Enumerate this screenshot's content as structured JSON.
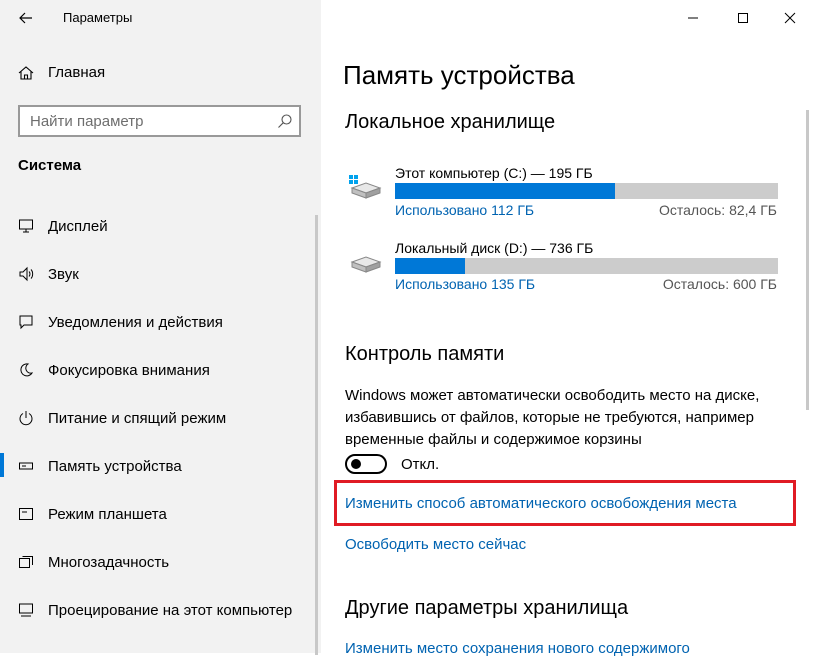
{
  "app_title": "Параметры",
  "sidebar": {
    "home_label": "Главная",
    "search_placeholder": "Найти параметр",
    "section_title": "Система",
    "items": [
      {
        "label": "Дисплей",
        "icon": "display-icon"
      },
      {
        "label": "Звук",
        "icon": "sound-icon"
      },
      {
        "label": "Уведомления и действия",
        "icon": "notifications-icon"
      },
      {
        "label": "Фокусировка внимания",
        "icon": "focus-assist-icon"
      },
      {
        "label": "Питание и спящий режим",
        "icon": "power-icon"
      },
      {
        "label": "Память устройства",
        "icon": "storage-icon",
        "active": true
      },
      {
        "label": "Режим планшета",
        "icon": "tablet-mode-icon"
      },
      {
        "label": "Многозадачность",
        "icon": "multitasking-icon"
      },
      {
        "label": "Проецирование на этот компьютер",
        "icon": "projecting-icon"
      }
    ]
  },
  "main": {
    "title": "Память устройства",
    "local_storage_title": "Локальное хранилище",
    "drives": [
      {
        "name": "Этот компьютер (C:) — 195 ГБ",
        "used": "Использовано 112 ГБ",
        "free": "Осталось: 82,4 ГБ",
        "used_fraction": 0.574,
        "icon": "windows-drive-icon"
      },
      {
        "name": "Локальный диск (D:) — 736 ГБ",
        "used": "Использовано 135 ГБ",
        "free": "Осталось: 600 ГБ",
        "used_fraction": 0.183,
        "icon": "drive-icon"
      }
    ],
    "storage_sense_title": "Контроль памяти",
    "storage_sense_desc": "Windows может автоматически освободить место на диске, избавившись от файлов, которые не требуются, например временные файлы и содержимое корзины",
    "toggle_label": "Откл.",
    "change_link": "Изменить способ автоматического освобождения места",
    "free_now_link": "Освободить место сейчас",
    "other_title": "Другие параметры хранилища",
    "other_link": "Изменить место сохранения нового содержимого"
  },
  "colors": {
    "accent": "#0078d7",
    "link": "#0063b1",
    "highlight": "#e01b24"
  }
}
